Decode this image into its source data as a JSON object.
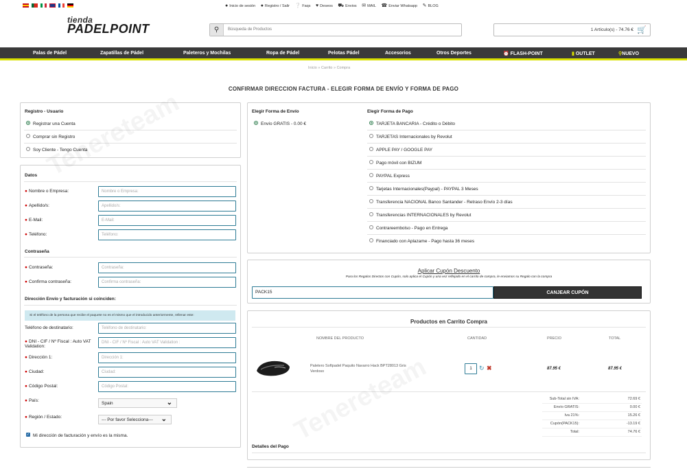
{
  "top": {
    "links": [
      {
        "icon": "user-icon",
        "label": "Inicio de sesión"
      },
      {
        "icon": "user-plus-icon",
        "label": "Registro / Salir"
      },
      {
        "icon": "question-icon",
        "label": "Faqs"
      },
      {
        "icon": "heart-icon",
        "label": "Deseos"
      },
      {
        "icon": "truck-icon",
        "label": "Envios"
      },
      {
        "icon": "mail-icon",
        "label": "MAIL"
      },
      {
        "icon": "whatsapp-icon",
        "label": "Enviar Whatsapp"
      },
      {
        "icon": "pencil-icon",
        "label": "BLOG"
      }
    ],
    "flags": [
      "es",
      "pt",
      "it",
      "gb",
      "fr",
      "de"
    ]
  },
  "logo": {
    "line1": "tienda",
    "line2": "PADELPOINT"
  },
  "search": {
    "placeholder": "Búsqueda de Productos"
  },
  "cart": {
    "summary": "1 Artículo(s) - 74.76 €"
  },
  "nav": [
    "Palas de Pádel",
    "Zapatillas de Pádel",
    "Paleteros y Mochilas",
    "Ropa de Pádel",
    "Pelotas Pádel",
    "Accesorios",
    "Otros Deportes",
    "FLASH-POINT",
    "OUTLET",
    "NUEVO"
  ],
  "breadcrumb": "Inicio  »  Carrito  »  Compra",
  "page_title": "CONFIRMAR DIRECCION FACTURA - ELEGIR FORMA DE ENVÍO Y FORMA DE PAGO",
  "registro": {
    "title": "Registro - Usuario",
    "options": [
      "Registrar una Cuenta",
      "Comprar sin Registro",
      "Soy Cliente - Tengo Cuenta"
    ]
  },
  "datos": {
    "title": "Datos",
    "fields": [
      {
        "label": "Nombre o Empresa:",
        "placeholder": "Nombre o Empresa:"
      },
      {
        "label": "Apellido/s:",
        "placeholder": "Apellido/s:"
      },
      {
        "label": "E-Mail:",
        "placeholder": "E-Mail:"
      },
      {
        "label": "Teléfono:",
        "placeholder": "Teléfono:"
      }
    ],
    "password_title": "Contraseña",
    "password_fields": [
      {
        "label": "Contraseña:",
        "placeholder": "Contraseña:"
      },
      {
        "label": "Confirma contraseña:",
        "placeholder": "Confirma contraseña:"
      }
    ],
    "address_title": "Dirección Envío y facturación si coinciden:",
    "info": "Si el teléfono de la persona que recibe el paquete no es el mismo que el introducido anteriormente, rellenar este:",
    "address_fields": [
      {
        "label": "Teléfono de destinatario:",
        "placeholder": "Teléfono de destinatario:"
      },
      {
        "label": "DNI - CIF / Nº Fiscal : Auto VAT Validation:",
        "placeholder": "DNI - CIF / Nº Fiscal :  Auto VAT Validation :"
      },
      {
        "label": "Dirección 1:",
        "placeholder": "Dirección 1:"
      },
      {
        "label": "Ciudad:",
        "placeholder": "Ciudad:"
      },
      {
        "label": "Código Postal:",
        "placeholder": "Código Postal:"
      }
    ],
    "pais_label": "País:",
    "pais_value": "Spain",
    "region_label": "Región / Estado:",
    "region_value": "--- Por favor Selecciona---",
    "same_address": "Mi dirección de facturación y envío es la misma."
  },
  "envio": {
    "title": "Elegir Forma de Envío",
    "option": "Envío GRATIS - 0.00 €"
  },
  "pago": {
    "title": "Elegir Forma de Pago",
    "options": [
      "TARJETA BANCARIA - Crédito o Débito",
      "TARJETAS Internacionales by Revolut",
      "APPLE PAY / GOOGLE PAY",
      "Pago móvil con BIZUM",
      "PAYPAL Express",
      "Tarjetas Internacionales(Paypal) - PAYPAL 3 Meses",
      "Transferencia NACIONAL Banco Santander - Retraso Envío 2-3 días",
      "Transferencias INTERNACIONALES by Revolut",
      "Contrareembolso - Pago en Entrega",
      "Financiado con Aplazame - Pago hasta 36 meses"
    ]
  },
  "cupon": {
    "title": "Aplicar Cupón Descuento",
    "subtitle": "Para los Regalos Directos con Cupón, solo aplica el Cupón y una vez reflejado en el carrito de compra, le enviamos su Regalo con la compra",
    "value": "PACK15",
    "button": "CANJEAR CUPÓN"
  },
  "carrito": {
    "title": "Productos en Carrito Compra",
    "headers": [
      "NOMBRE DEL PRODUCTO",
      "CANTIDAD",
      "PRECIO",
      "TOTAL"
    ],
    "item": {
      "name": "Paletero Softpadel Paquito Navarro Hack BPT28013 Gris Verdoso",
      "qty": "1",
      "price": "87.95 €",
      "total": "87.95 €"
    },
    "totals": [
      {
        "label": "Sub-Total sin IVA:",
        "value": "72.69 €"
      },
      {
        "label": "Envío GRATIS:",
        "value": "0.00 €"
      },
      {
        "label": "Iva 21%:",
        "value": "15.26 €"
      },
      {
        "label": "Cupón(PACK15):",
        "value": "-13.19 €"
      },
      {
        "label": "Total:",
        "value": "74.76 €"
      }
    ]
  },
  "detalles": {
    "title": "Detalles del Pago"
  },
  "watermark": "Tenereteam"
}
